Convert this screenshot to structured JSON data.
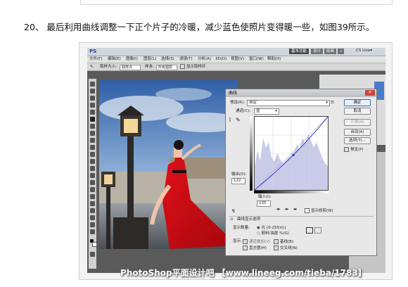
{
  "caption": "20、 最后利用曲线调整一下正个片子的冷暖，减少蓝色使照片变得暖一些，如图39所示。",
  "app": {
    "logo": "PS",
    "workspace_buttons": [
      "基本功能",
      "设计",
      "绘画",
      "»"
    ],
    "cs_live": "CS Live▾",
    "menu": [
      "文件(F)",
      "编辑(E)",
      "图像(I)",
      "图层(L)",
      "选择(S)",
      "滤镜(T)",
      "分析(A)",
      "3D(D)",
      "视图(V)",
      "窗口(W)",
      "帮助(H)"
    ],
    "options": {
      "sample_label": "取样大小:",
      "sample_value": "取样点",
      "sample_label2": "样本:",
      "sample_value2": "所有图层",
      "show_ring": "显示取样环"
    }
  },
  "dialog": {
    "title": "曲线",
    "preset_label": "预设(R):",
    "preset_value": "自定",
    "channel_label": "通道(C):",
    "channel_value": "蓝",
    "output_label": "输出(O):",
    "output_value": "122",
    "input_label": "输入(I):",
    "input_value": "135",
    "show_clipping": "显示修剪(W)",
    "curve_display": "曲线显示选项",
    "amount_label": "显示数量:",
    "radio_light": "光 (0-255)(L)",
    "radio_pigment": "颜料/油墨 %(G)",
    "show_label": "显示:",
    "cb_channel_overlay": "通道叠加(V)",
    "cb_baseline": "基线(B)",
    "cb_histogram": "直方图(H)",
    "cb_intersection": "交叉线(N)",
    "buttons": {
      "ok": "确定",
      "cancel": "取消",
      "smooth": "平滑(M)",
      "auto": "自动(A)",
      "options": "选项(T)...",
      "preview": "预览(P)"
    },
    "curve_point": {
      "input": 135,
      "output": 122
    }
  },
  "watermark": "PhotoShop平面设计吧 【www.lineeg.com/tieba/1783】"
}
